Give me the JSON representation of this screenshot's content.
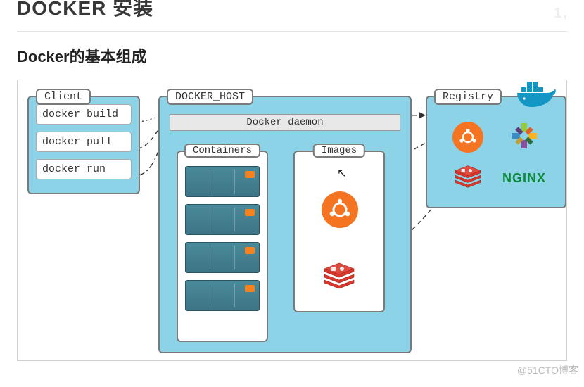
{
  "headings": {
    "title_truncated": "DOCKER 安装",
    "subtitle": "Docker的基本组成"
  },
  "diagram": {
    "client": {
      "label": "Client",
      "commands": [
        "docker build",
        "docker pull",
        "docker run"
      ]
    },
    "host": {
      "label": "DOCKER_HOST",
      "daemon": "Docker daemon",
      "containers_label": "Containers",
      "images_label": "Images",
      "containers_count": 4,
      "images": [
        "ubuntu",
        "redis"
      ]
    },
    "registry": {
      "label": "Registry",
      "items": [
        "ubuntu",
        "centos",
        "redis",
        "nginx"
      ],
      "nginx_text": "NGINX"
    },
    "mascot": "docker-whale"
  },
  "watermark": "@51CTO博客",
  "ghost_text": "1,",
  "colors": {
    "panel_bg": "#8cd3e8",
    "ubuntu": "#f47421",
    "redis": "#d9372c",
    "nginx": "#0a8a3a",
    "whale": "#1396c3"
  }
}
